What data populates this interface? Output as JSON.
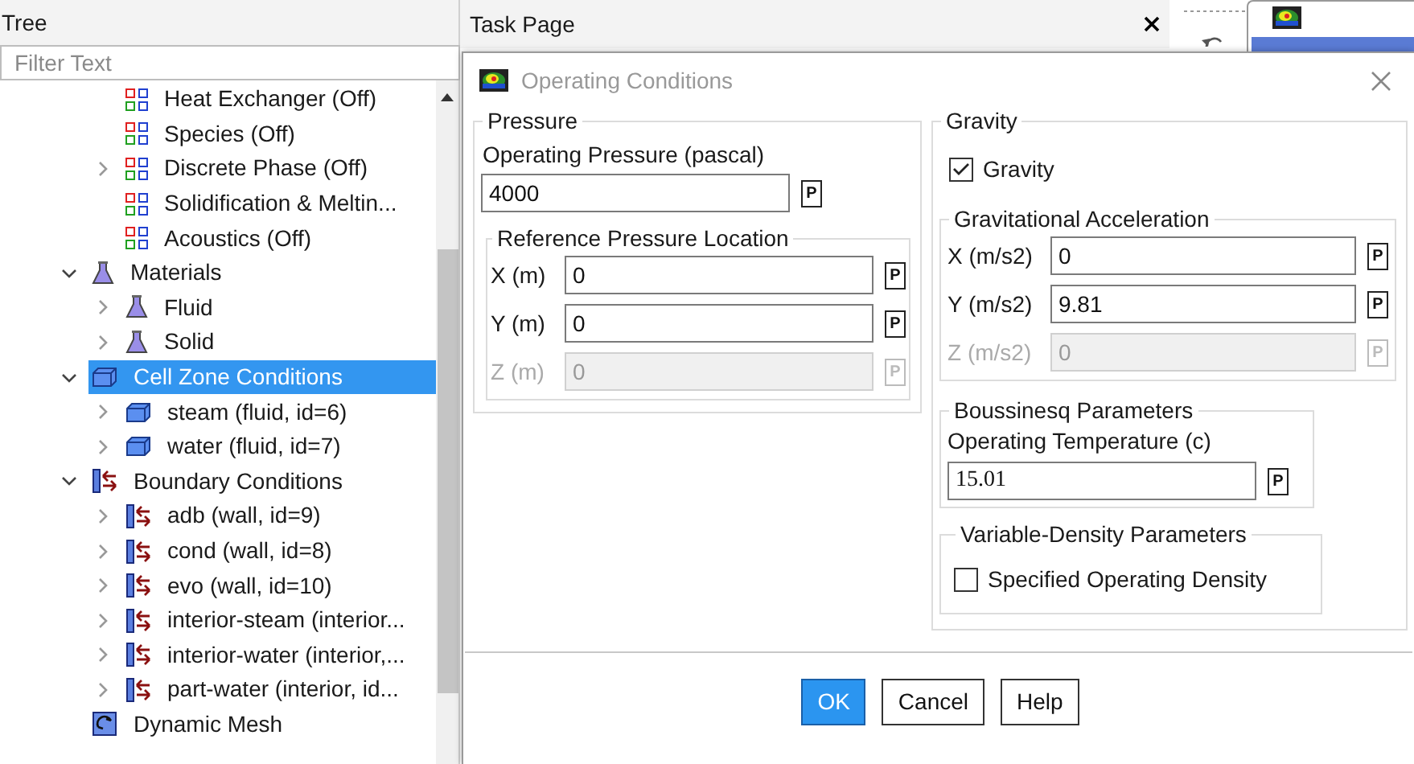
{
  "tree": {
    "title": "Tree",
    "filter": {
      "placeholder": "Filter Text"
    },
    "items": [
      {
        "children": [
          {
            "label": "Heat Exchanger (Off)",
            "kind": "model",
            "selected": false
          },
          {
            "label": "Species (Off)",
            "kind": "model",
            "selected": false
          },
          {
            "label": "Discrete Phase (Off)",
            "kind": "model",
            "expanded": false,
            "selected": false
          },
          {
            "label": "Solidification & Meltin...",
            "kind": "model",
            "selected": false
          },
          {
            "label": "Acoustics (Off)",
            "kind": "model",
            "selected": false
          }
        ]
      },
      {
        "label": "Materials",
        "kind": "flask",
        "expanded": true,
        "selected": false,
        "children": [
          {
            "label": "Fluid",
            "kind": "flask",
            "expanded": false,
            "selected": false
          },
          {
            "label": "Solid",
            "kind": "flask",
            "expanded": false,
            "selected": false
          }
        ]
      },
      {
        "label": "Cell Zone Conditions",
        "kind": "zone",
        "expanded": true,
        "selected": true,
        "children": [
          {
            "label": "steam (fluid, id=6)",
            "kind": "zone",
            "expanded": false,
            "selected": false
          },
          {
            "label": "water (fluid, id=7)",
            "kind": "zone",
            "expanded": false,
            "selected": false
          }
        ]
      },
      {
        "label": "Boundary Conditions",
        "kind": "boundary",
        "expanded": true,
        "selected": false,
        "children": [
          {
            "label": "adb (wall, id=9)",
            "kind": "boundary",
            "expanded": false,
            "selected": false
          },
          {
            "label": "cond (wall, id=8)",
            "kind": "boundary",
            "expanded": false,
            "selected": false
          },
          {
            "label": "evo (wall, id=10)",
            "kind": "boundary",
            "expanded": false,
            "selected": false
          },
          {
            "label": "interior-steam (interior...",
            "kind": "boundary",
            "expanded": false,
            "selected": false
          },
          {
            "label": "interior-water (interior,...",
            "kind": "boundary",
            "expanded": false,
            "selected": false
          },
          {
            "label": "part-water (interior, id...",
            "kind": "boundary",
            "expanded": false,
            "selected": false
          }
        ]
      },
      {
        "label": "Dynamic Mesh",
        "kind": "mesh",
        "selected": false
      }
    ]
  },
  "task_page": {
    "title": "Task Page"
  },
  "dialog": {
    "title": "Operating Conditions",
    "pressure": {
      "title": "Pressure",
      "operating_pressure": {
        "label": "Operating Pressure (pascal)",
        "value": "4000",
        "param": "P"
      },
      "reference_location": {
        "title": "Reference Pressure Location",
        "rows": [
          {
            "label": "X (m)",
            "value": "0",
            "param": "P",
            "disabled": false
          },
          {
            "label": "Y (m)",
            "value": "0",
            "param": "P",
            "disabled": false
          },
          {
            "label": "Z (m)",
            "value": "0",
            "param": "P",
            "disabled": true
          }
        ]
      }
    },
    "gravity": {
      "title": "Gravity",
      "checkbox": {
        "label": "Gravity",
        "checked": true
      },
      "acceleration": {
        "title": "Gravitational Acceleration",
        "rows": [
          {
            "label": "X (m/s2)",
            "value": "0",
            "param": "P",
            "disabled": false
          },
          {
            "label": "Y (m/s2)",
            "value": "9.81",
            "param": "P",
            "disabled": false
          },
          {
            "label": "Z (m/s2)",
            "value": "0",
            "param": "P",
            "disabled": true
          }
        ]
      },
      "boussinesq": {
        "title": "Boussinesq Parameters",
        "label": "Operating Temperature (c)",
        "value": "15.01",
        "param": "P"
      },
      "variable_density": {
        "title": "Variable-Density Parameters",
        "checkbox": {
          "label": "Specified Operating Density",
          "checked": false
        }
      }
    },
    "buttons": [
      {
        "label": "OK",
        "default": true
      },
      {
        "label": "Cancel",
        "default": false
      },
      {
        "label": "Help",
        "default": false
      }
    ]
  }
}
